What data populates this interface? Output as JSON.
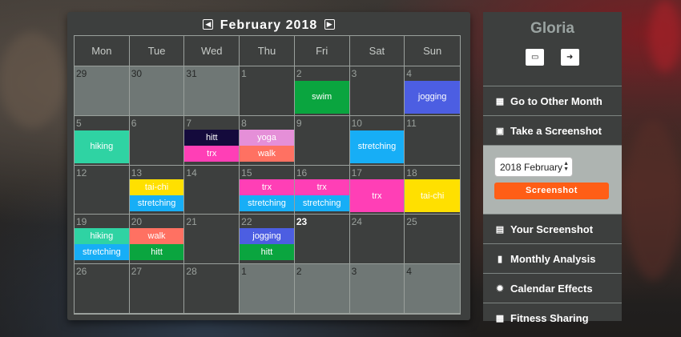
{
  "calendar": {
    "title": "February 2018",
    "prev_icon": "chevron-left-icon",
    "next_icon": "chevron-right-icon",
    "weekdays": [
      "Mon",
      "Tue",
      "Wed",
      "Thu",
      "Fri",
      "Sat",
      "Sun"
    ],
    "days": [
      {
        "num": "29",
        "other": true,
        "events": []
      },
      {
        "num": "30",
        "other": true,
        "events": []
      },
      {
        "num": "31",
        "other": true,
        "events": []
      },
      {
        "num": "1",
        "other": false,
        "events": []
      },
      {
        "num": "2",
        "other": false,
        "events": [
          {
            "label": "swim",
            "color": "#0aa53f"
          }
        ]
      },
      {
        "num": "3",
        "other": false,
        "events": []
      },
      {
        "num": "4",
        "other": false,
        "events": [
          {
            "label": "jogging",
            "color": "#4c5ee2"
          }
        ]
      },
      {
        "num": "5",
        "other": false,
        "events": [
          {
            "label": "hiking",
            "color": "#2fd3a3"
          }
        ]
      },
      {
        "num": "6",
        "other": false,
        "events": []
      },
      {
        "num": "7",
        "other": false,
        "events": [
          {
            "label": "hitt",
            "color": "#140a3c"
          },
          {
            "label": "trx",
            "color": "#ff3fb6"
          }
        ]
      },
      {
        "num": "8",
        "other": false,
        "events": [
          {
            "label": "yoga",
            "color": "#e58fd8"
          },
          {
            "label": "walk",
            "color": "#ff7162"
          }
        ]
      },
      {
        "num": "9",
        "other": false,
        "events": []
      },
      {
        "num": "10",
        "other": false,
        "events": [
          {
            "label": "stretching",
            "color": "#17aef6"
          }
        ]
      },
      {
        "num": "11",
        "other": false,
        "events": []
      },
      {
        "num": "12",
        "other": false,
        "events": []
      },
      {
        "num": "13",
        "other": false,
        "events": [
          {
            "label": "tai-chi",
            "color": "#ffe000"
          },
          {
            "label": "stretching",
            "color": "#17aef6"
          }
        ]
      },
      {
        "num": "14",
        "other": false,
        "events": []
      },
      {
        "num": "15",
        "other": false,
        "events": [
          {
            "label": "trx",
            "color": "#ff3fb6"
          },
          {
            "label": "stretching",
            "color": "#17aef6"
          }
        ]
      },
      {
        "num": "16",
        "other": false,
        "events": [
          {
            "label": "trx",
            "color": "#ff3fb6"
          },
          {
            "label": "stretching",
            "color": "#17aef6"
          }
        ]
      },
      {
        "num": "17",
        "other": false,
        "events": [
          {
            "label": "trx",
            "color": "#ff3fb6"
          }
        ]
      },
      {
        "num": "18",
        "other": false,
        "events": [
          {
            "label": "tai-chi",
            "color": "#ffe000"
          }
        ]
      },
      {
        "num": "19",
        "other": false,
        "events": [
          {
            "label": "hiking",
            "color": "#2fd3a3"
          },
          {
            "label": "stretching",
            "color": "#17aef6"
          }
        ]
      },
      {
        "num": "20",
        "other": false,
        "events": [
          {
            "label": "walk",
            "color": "#ff7162"
          },
          {
            "label": "hitt",
            "color": "#0aa53f"
          }
        ]
      },
      {
        "num": "21",
        "other": false,
        "events": []
      },
      {
        "num": "22",
        "other": false,
        "events": [
          {
            "label": "jogging",
            "color": "#4c5ee2"
          },
          {
            "label": "hitt",
            "color": "#0aa53f"
          }
        ]
      },
      {
        "num": "23",
        "other": false,
        "today": true,
        "events": []
      },
      {
        "num": "24",
        "other": false,
        "events": []
      },
      {
        "num": "25",
        "other": false,
        "events": []
      },
      {
        "num": "26",
        "other": false,
        "events": []
      },
      {
        "num": "27",
        "other": false,
        "events": []
      },
      {
        "num": "28",
        "other": false,
        "events": []
      },
      {
        "num": "1",
        "other": true,
        "events": []
      },
      {
        "num": "2",
        "other": true,
        "events": []
      },
      {
        "num": "3",
        "other": true,
        "events": []
      },
      {
        "num": "4",
        "other": true,
        "events": []
      }
    ]
  },
  "sidebar": {
    "user_name": "Gloria",
    "icons": [
      {
        "name": "folder-open-icon",
        "glyph": "📂"
      },
      {
        "name": "sign-out-icon",
        "glyph": "➜"
      }
    ],
    "menu_top": [
      {
        "key": "go-to-other-month",
        "label": "Go to Other Month",
        "icon": "calendar-icon",
        "glyph": "▦"
      },
      {
        "key": "take-a-screenshot",
        "label": "Take a Screenshot",
        "icon": "camera-icon",
        "glyph": "▣"
      }
    ],
    "screenshot_panel": {
      "selected_month": "2018 February",
      "button_label": "Screenshot"
    },
    "menu_bottom": [
      {
        "key": "your-screenshot",
        "label": "Your Screenshot",
        "icon": "image-icon",
        "glyph": "▤"
      },
      {
        "key": "monthly-analysis",
        "label": "Monthly Analysis",
        "icon": "file-icon",
        "glyph": "▮"
      },
      {
        "key": "calendar-effects",
        "label": "Calendar Effects",
        "icon": "sun-icon",
        "glyph": "✹"
      },
      {
        "key": "fitness-sharing",
        "label": "Fitness Sharing",
        "icon": "print-icon",
        "glyph": "▩"
      }
    ]
  }
}
